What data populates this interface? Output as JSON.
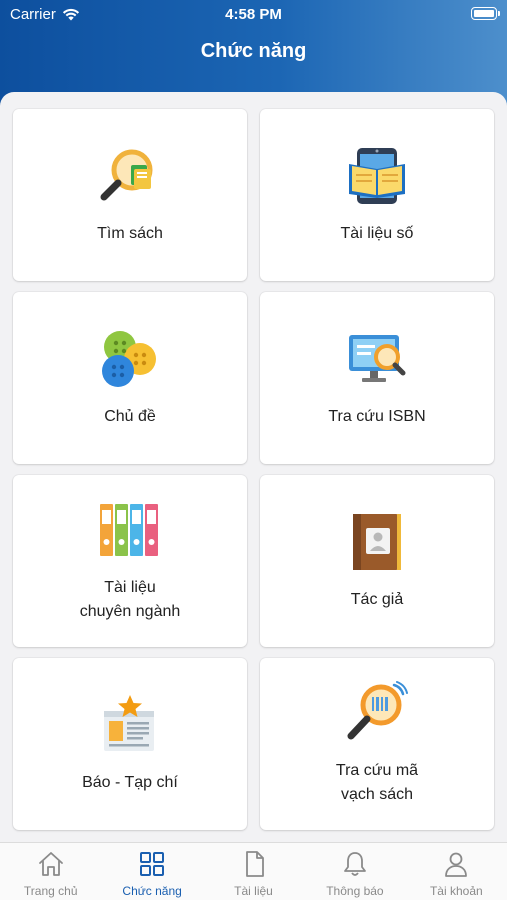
{
  "status_bar": {
    "carrier": "Carrier",
    "time": "4:58 PM"
  },
  "header": {
    "title": "Chức năng"
  },
  "functions": [
    {
      "label": "Tìm sách",
      "icon": "book-search-icon"
    },
    {
      "label": "Tài liệu số",
      "icon": "digital-book-icon"
    },
    {
      "label": "Chủ đề",
      "icon": "buttons-topic-icon"
    },
    {
      "label": "Tra cứu ISBN",
      "icon": "monitor-search-icon"
    },
    {
      "label": "Tài liệu\nchuyên ngành",
      "icon": "binders-icon"
    },
    {
      "label": "Tác giả",
      "icon": "author-book-icon"
    },
    {
      "label": "Báo - Tạp chí",
      "icon": "newspaper-icon"
    },
    {
      "label": "Tra cứu mã\nvạch sách",
      "icon": "barcode-search-icon"
    }
  ],
  "tabs": [
    {
      "label": "Trang chủ",
      "icon": "home-icon",
      "active": false
    },
    {
      "label": "Chức năng",
      "icon": "grid-icon",
      "active": true
    },
    {
      "label": "Tài liệu",
      "icon": "document-icon",
      "active": false
    },
    {
      "label": "Thông báo",
      "icon": "bell-icon",
      "active": false
    },
    {
      "label": "Tài khoản",
      "icon": "user-icon",
      "active": false
    }
  ],
  "colors": {
    "header_start": "#0d4f9e",
    "header_end": "#4d8fcc",
    "active_tab": "#1a5fb0",
    "inactive_tab": "#8a8a8a"
  }
}
